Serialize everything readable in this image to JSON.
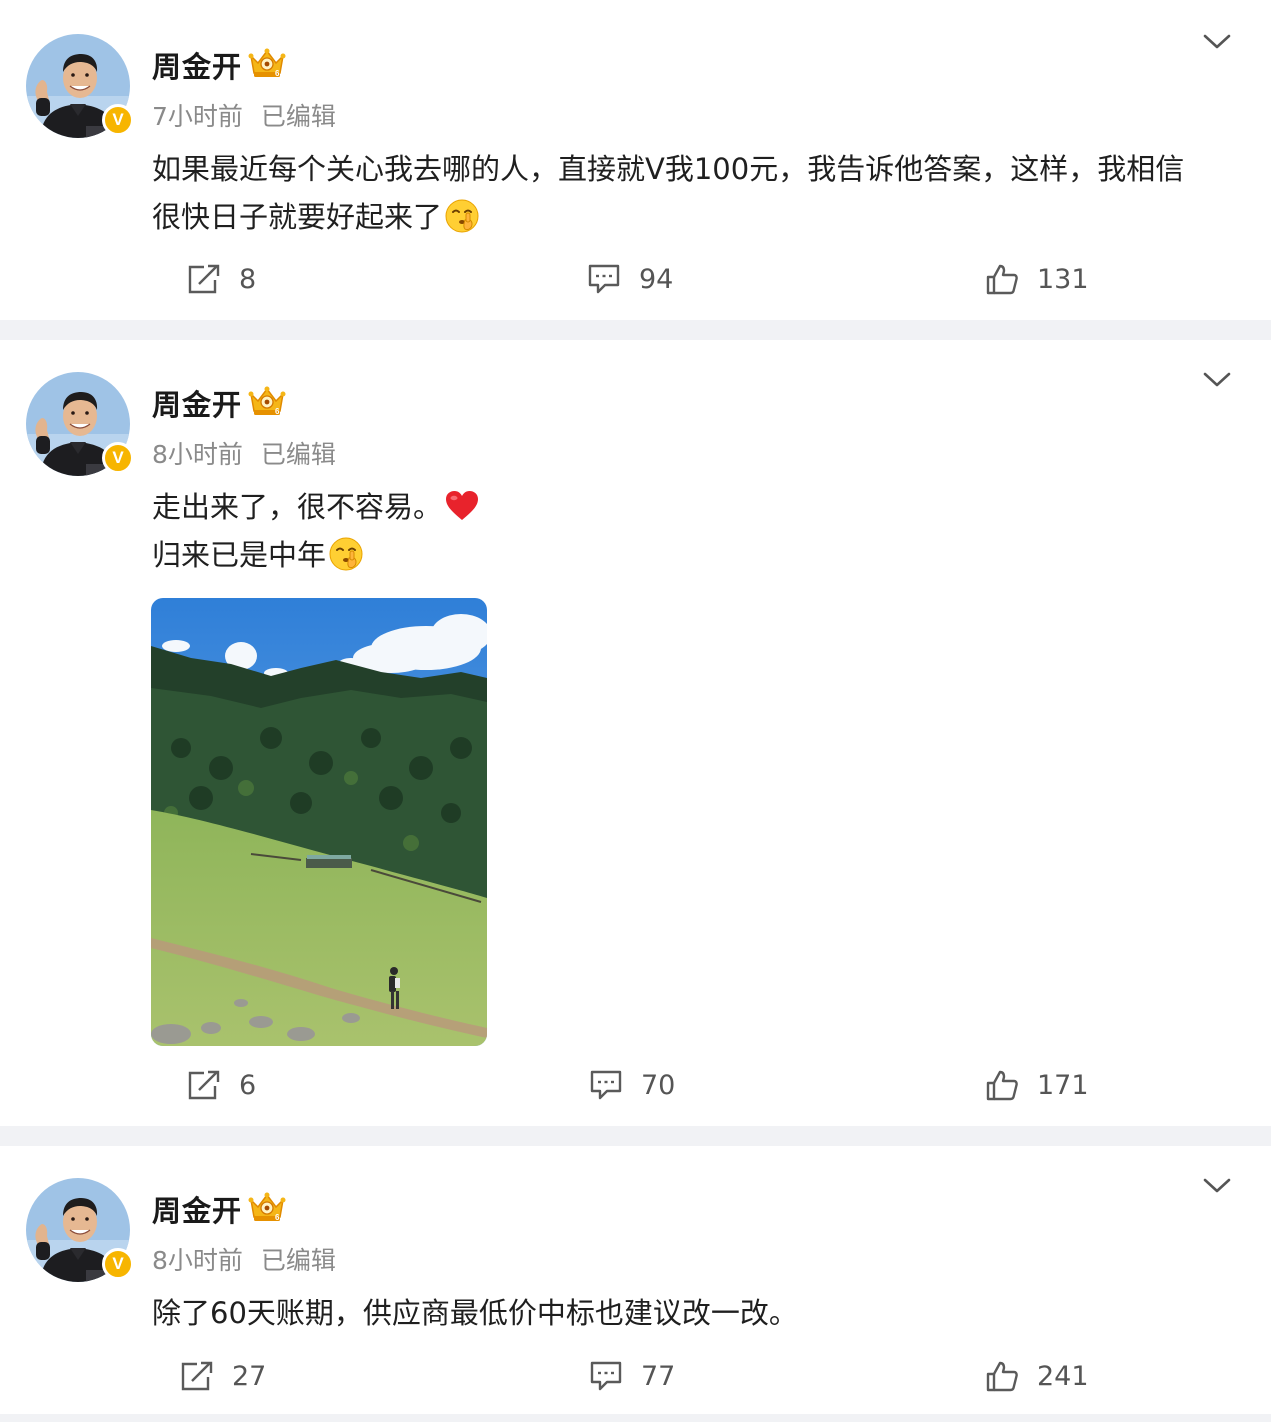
{
  "posts": [
    {
      "author": "周金开",
      "verified_badge": "V",
      "time": "7小时前",
      "edited": "已编辑",
      "text_lines": [
        "如果最近每个关心我去哪的人，直接就V我100元，我告诉他答案，这样，我相信",
        "很快日子就要好起来了"
      ],
      "repost_count": "8",
      "comment_count": "94",
      "like_count": "131"
    },
    {
      "author": "周金开",
      "verified_badge": "V",
      "time": "8小时前",
      "edited": "已编辑",
      "text_lines": [
        "走出来了，很不容易。",
        "归来已是中年"
      ],
      "repost_count": "6",
      "comment_count": "70",
      "like_count": "171"
    },
    {
      "author": "周金开",
      "verified_badge": "V",
      "time": "8小时前",
      "edited": "已编辑",
      "text_lines": [
        "除了60天账期，供应商最低价中标也建议改一改。"
      ],
      "repost_count": "27",
      "comment_count": "77",
      "like_count": "241"
    }
  ],
  "icons": {
    "repost": "repost-icon",
    "comment": "comment-icon",
    "like": "like-icon",
    "more": "chevron-down-icon",
    "member": "crown-icon",
    "emoji_shush": "shushing-face-emoji",
    "emoji_heart": "red-heart-emoji"
  },
  "colors": {
    "verified": "#f7b500",
    "heart": "#e8232c",
    "text": "#1f1f1f",
    "meta": "#8a8a8a"
  }
}
